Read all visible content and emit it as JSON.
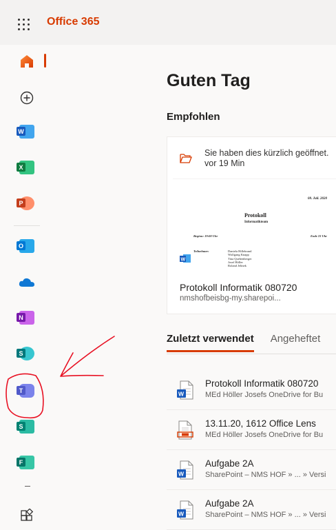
{
  "header": {
    "brand": "Office 365"
  },
  "rail": {
    "items": [
      {
        "key": "home",
        "label": "Home"
      },
      {
        "key": "create",
        "label": "Create"
      },
      {
        "key": "word",
        "letter": "W",
        "color": "#185abd"
      },
      {
        "key": "excel",
        "letter": "X",
        "color": "#107c41"
      },
      {
        "key": "powerpoint",
        "letter": "P",
        "color": "#c43e1c"
      },
      {
        "key": "outlook",
        "letter": "O",
        "color": "#0078d4"
      },
      {
        "key": "onedrive",
        "color": "#0364b8"
      },
      {
        "key": "onenote",
        "letter": "N",
        "color": "#7719aa"
      },
      {
        "key": "sharepoint",
        "letter": "S",
        "color": "#03787c"
      },
      {
        "key": "teams",
        "letter": "T",
        "color": "#5059c9"
      },
      {
        "key": "sway",
        "letter": "S",
        "color": "#008272"
      },
      {
        "key": "forms",
        "letter": "F",
        "color": "#077568"
      },
      {
        "key": "all-apps"
      }
    ]
  },
  "main": {
    "greeting": "Guten Tag",
    "recommended": {
      "title": "Empfohlen",
      "card": {
        "activity": "Sie haben dies kürzlich geöffnet.",
        "time": "vor 19 Min",
        "thumbnail": {
          "date": "08. Juli. 2020",
          "title": "Protokoll",
          "subtitle": "Informatikteam",
          "begin": "Beginn: 19:00 Uhr",
          "end": "Ende 23 Uhr",
          "participants_label": "Teilnehmer:",
          "participants": [
            "Daniela Hillebrand",
            "Wolfgang Knapp",
            "Tina Quehenberger",
            "Josef Höller",
            "Roland Jelinek"
          ]
        },
        "name": "Protokoll Informatik 080720",
        "location": "nmshofbeisbg-my.sharepoi..."
      }
    },
    "tabs": [
      {
        "label": "Zuletzt verwendet",
        "active": true
      },
      {
        "label": "Angeheftet",
        "active": false
      }
    ],
    "files": [
      {
        "type": "word",
        "name": "Protokoll Informatik 080720",
        "location": "MEd Höller Josefs OneDrive for Bu"
      },
      {
        "type": "lens",
        "name": "13.11.20, 1612 Office Lens",
        "location": "MEd Höller Josefs OneDrive for Bu"
      },
      {
        "type": "word",
        "name": "Aufgabe 2A",
        "location": "SharePoint – NMS HOF » ... » Versi"
      },
      {
        "type": "word",
        "name": "Aufgabe 2A",
        "location": "SharePoint – NMS HOF » ... » Versi"
      }
    ]
  },
  "colors": {
    "accent": "#d83b01",
    "annotation": "#e81123"
  }
}
